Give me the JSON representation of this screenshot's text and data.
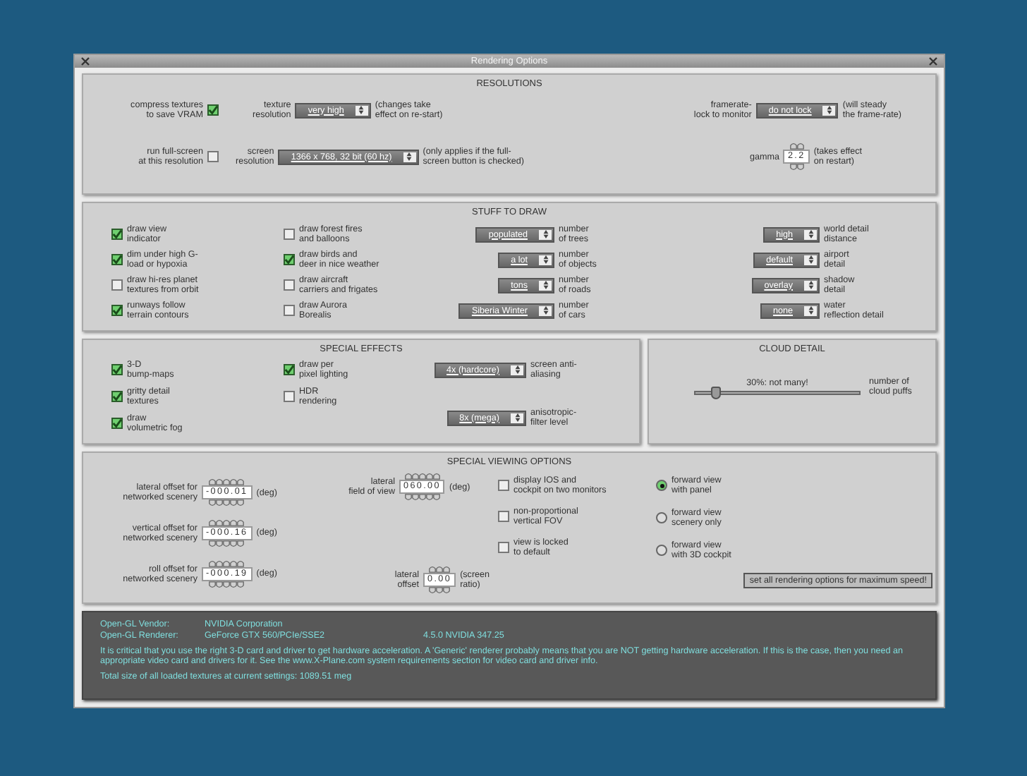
{
  "window": {
    "title": "Rendering Options"
  },
  "resolutions": {
    "title": "RESOLUTIONS",
    "rows": [
      [
        {
          "kind": "checkbox",
          "label": "compress textures\nto save VRAM",
          "checked": true
        },
        {
          "kind": "dropdown",
          "label": "texture\nresolution",
          "value": "very high",
          "note": "(changes take\neffect on re-start)"
        },
        {
          "kind": "dropdown",
          "label": "framerate-\nlock to monitor",
          "value": "do not lock",
          "note": "(will steady\nthe frame-rate)"
        }
      ],
      [
        {
          "kind": "checkbox",
          "label": "run full-screen\nat this resolution",
          "checked": false
        },
        {
          "kind": "dropdown",
          "label": "screen\nresolution",
          "value": "1366 x 768, 32 bit (60 hz)",
          "note": "(only applies if the full-\nscreen button is checked)"
        },
        {
          "kind": "spinner",
          "label": "gamma",
          "value": "2.2",
          "note": "(takes effect\non restart)"
        }
      ]
    ]
  },
  "stuff_to_draw": {
    "title": "STUFF TO DRAW",
    "rows": [
      [
        {
          "kind": "checkbox",
          "label": "draw view\nindicator",
          "checked": true
        },
        {
          "kind": "checkbox",
          "label": "draw forest fires\nand balloons",
          "checked": false
        },
        {
          "kind": "dropdown",
          "value": "populated",
          "caption": "number\nof trees"
        },
        {
          "kind": "dropdown",
          "value": "high",
          "caption": "world detail\ndistance"
        }
      ],
      [
        {
          "kind": "checkbox",
          "label": "dim under high G-\nload or hypoxia",
          "checked": true
        },
        {
          "kind": "checkbox",
          "label": "draw birds and\ndeer in nice weather",
          "checked": true
        },
        {
          "kind": "dropdown",
          "value": "a lot",
          "caption": "number\nof objects"
        },
        {
          "kind": "dropdown",
          "value": "default",
          "caption": "airport\ndetail"
        }
      ],
      [
        {
          "kind": "checkbox",
          "label": "draw hi-res planet\ntextures from orbit",
          "checked": false
        },
        {
          "kind": "checkbox",
          "label": "draw aircraft\ncarriers and frigates",
          "checked": false
        },
        {
          "kind": "dropdown",
          "value": "tons",
          "caption": "number\nof roads"
        },
        {
          "kind": "dropdown",
          "value": "overlay",
          "caption": "shadow\ndetail"
        }
      ],
      [
        {
          "kind": "checkbox",
          "label": "runways follow\nterrain contours",
          "checked": true
        },
        {
          "kind": "checkbox",
          "label": "draw Aurora\nBorealis",
          "checked": false
        },
        {
          "kind": "dropdown",
          "value": "Siberia Winter",
          "caption": "number\nof cars"
        },
        {
          "kind": "dropdown",
          "value": "none",
          "caption": "water\nreflection detail"
        }
      ]
    ]
  },
  "special_effects": {
    "title": "SPECIAL EFFECTS",
    "columns": [
      [
        {
          "kind": "checkbox",
          "label": "3-D\nbump-maps",
          "checked": true
        },
        {
          "kind": "checkbox",
          "label": "gritty detail\ntextures",
          "checked": true
        },
        {
          "kind": "checkbox",
          "label": "draw\nvolumetric fog",
          "checked": true
        }
      ],
      [
        {
          "kind": "checkbox",
          "label": "draw per\npixel lighting",
          "checked": true
        },
        {
          "kind": "checkbox",
          "label": "HDR\nrendering",
          "checked": false
        }
      ],
      [
        {
          "kind": "dropdown",
          "value": "4x (hardcore)",
          "label": "screen anti-\naliasing"
        },
        {
          "kind": "dropdown",
          "value": "8x (mega)",
          "label": "anisotropic-\nfilter level"
        }
      ]
    ]
  },
  "cloud_detail": {
    "title": "CLOUD DETAIL",
    "reading": "30%: not many!",
    "level": 0.12,
    "label": "number of\ncloud puffs"
  },
  "special_viewing_options": {
    "title": "SPECIAL VIEWING OPTIONS",
    "columns": [
      [
        {
          "kind": "spinner",
          "label": "lateral offset for\nnetworked scenery",
          "value": "-000.01",
          "unit": "(deg)"
        },
        {
          "kind": "spinner",
          "label": "vertical offset for\nnetworked scenery",
          "value": "-000.16",
          "unit": "(deg)"
        },
        {
          "kind": "spinner",
          "label": "roll offset for\nnetworked scenery",
          "value": "-000.19",
          "unit": "(deg)"
        }
      ],
      [
        {
          "kind": "spinner",
          "label": "lateral\nfield of view",
          "value": "060.00",
          "unit": "(deg)"
        },
        {
          "kind": "spinner",
          "label": "lateral\noffset",
          "value": "0.00",
          "unit": "(screen\nratio)"
        }
      ],
      [
        {
          "kind": "checkbox",
          "label": "display IOS and\ncockpit on two monitors",
          "checked": false
        },
        {
          "kind": "checkbox",
          "label": "non-proportional\nvertical FOV",
          "checked": false
        },
        {
          "kind": "checkbox",
          "label": "view is locked\nto default",
          "checked": false
        }
      ],
      [
        {
          "kind": "radio",
          "label": "forward view\nwith panel",
          "selected": true
        },
        {
          "kind": "radio",
          "label": "forward view\nscenery only",
          "selected": false
        },
        {
          "kind": "radio",
          "label": "forward view\nwith 3D cockpit",
          "selected": false
        },
        {
          "kind": "button",
          "label": "set all rendering options for maximum speed!"
        }
      ]
    ]
  },
  "info": {
    "rows": [
      {
        "label": "Open-GL Vendor:",
        "value": "NVIDIA Corporation"
      },
      {
        "label": "Open-GL Renderer:",
        "value": "GeForce GTX 560/PCIe/SSE2",
        "extra": "4.5.0 NVIDIA 347.25"
      }
    ],
    "notice": "It is critical that you use the right 3-D card and driver to get hardware acceleration. A 'Generic' renderer probably means that you are NOT getting hardware acceleration. If this is the case, then you need an appropriate video card and drivers for it. See the www.X-Plane.com system requirements section for video card and driver info.",
    "total": "Total size of all loaded textures at current settings: 1089.51 meg"
  }
}
